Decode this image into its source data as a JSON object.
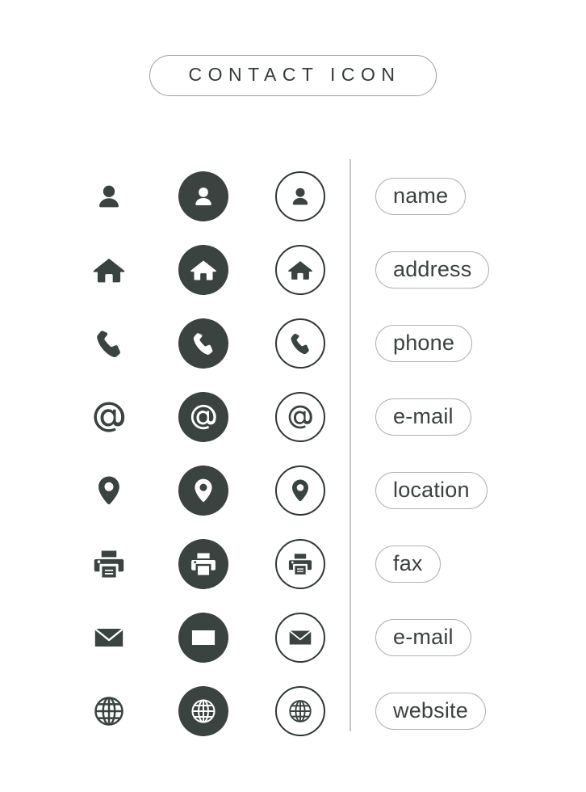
{
  "page": {
    "title": "CONTACT ICON",
    "background_color": "#ffffff",
    "icon_dark_color": "#3a433f",
    "outline_color": "#2f3835",
    "pill_border_color": "#aeb3b2",
    "divider_color": "#c3c7c6",
    "text_color": "#3a423f"
  },
  "columns": [
    {
      "key": "plain",
      "name": "plain-glyph"
    },
    {
      "key": "filled",
      "name": "filled-circle"
    },
    {
      "key": "outline",
      "name": "outlined-circle"
    }
  ],
  "rows": [
    {
      "icon": "person-icon",
      "label": "name"
    },
    {
      "icon": "home-icon",
      "label": "address"
    },
    {
      "icon": "phone-icon",
      "label": "phone"
    },
    {
      "icon": "at-sign-icon",
      "label": "e-mail"
    },
    {
      "icon": "location-icon",
      "label": "location"
    },
    {
      "icon": "printer-icon",
      "label": "fax"
    },
    {
      "icon": "envelope-icon",
      "label": "e-mail"
    },
    {
      "icon": "globe-icon",
      "label": "website"
    }
  ]
}
